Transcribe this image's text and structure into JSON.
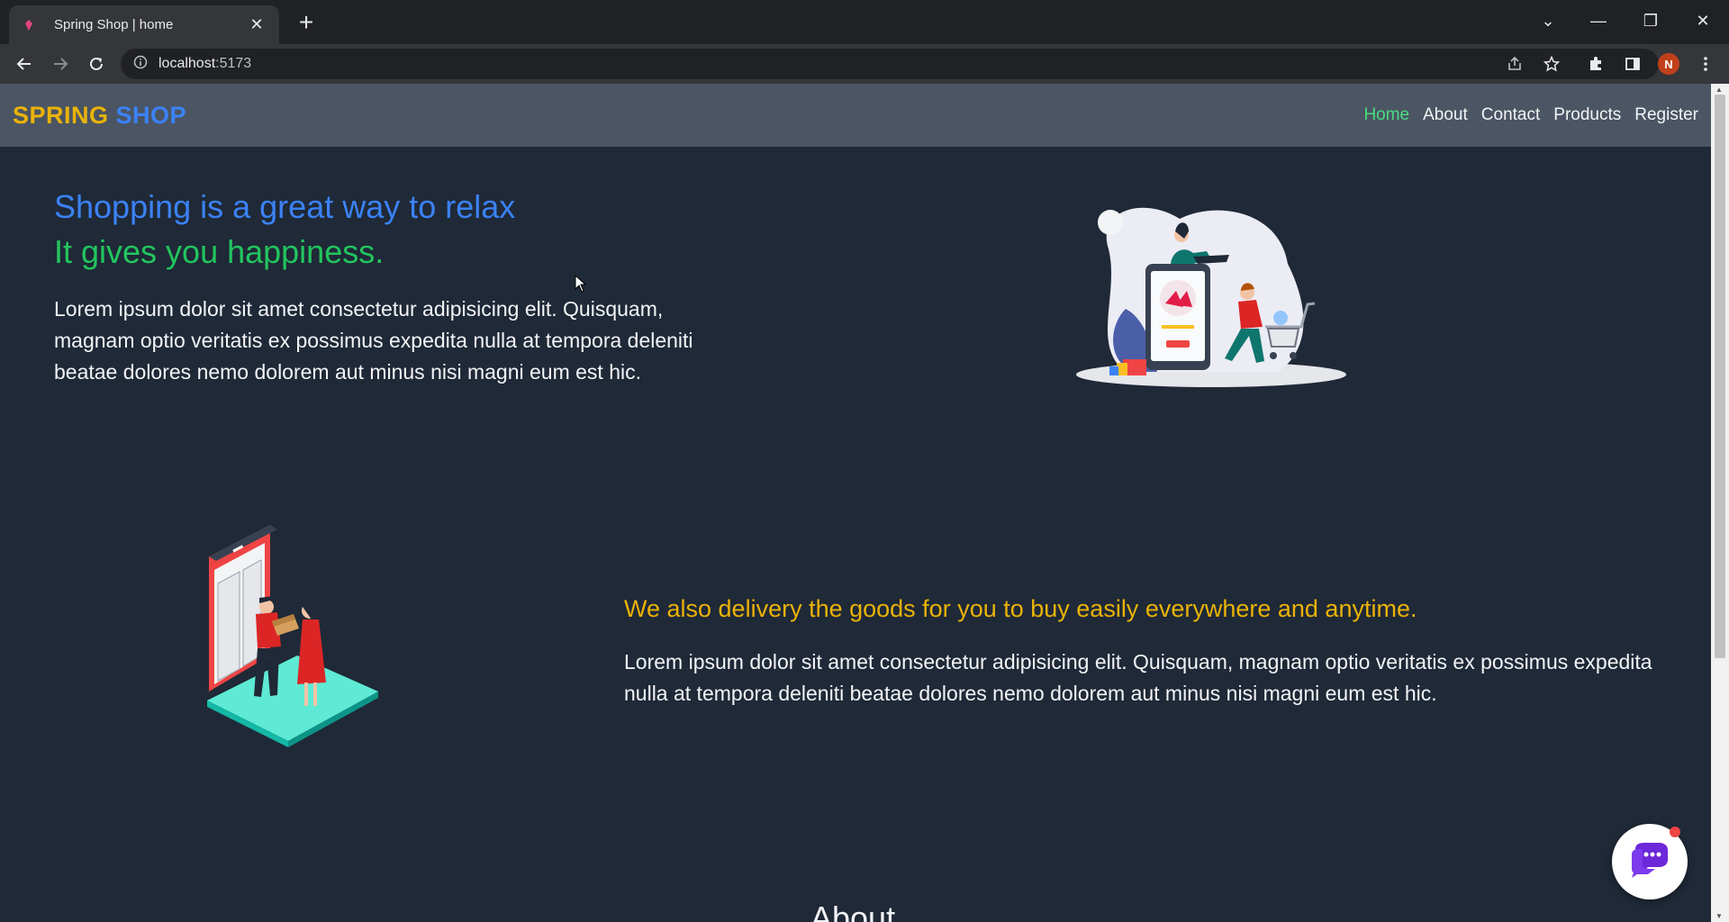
{
  "browser": {
    "tab_title": "Spring Shop | home",
    "url_host": "localhost",
    "url_port": ":5173",
    "profile_initial": "N",
    "icons": [
      "back-icon",
      "forward-icon",
      "reload-icon",
      "info-icon",
      "share-icon",
      "star-icon",
      "extensions-icon",
      "side-panel-icon",
      "menu-icon"
    ]
  },
  "navbar": {
    "brand_part1": "SPRING",
    "brand_part2": "SHOP",
    "links": [
      {
        "label": "Home",
        "active": true
      },
      {
        "label": "About",
        "active": false
      },
      {
        "label": "Contact",
        "active": false
      },
      {
        "label": "Products",
        "active": false
      },
      {
        "label": "Register",
        "active": false
      }
    ]
  },
  "hero": {
    "title": "Shopping is a great way to relax",
    "subtitle": "It gives you happiness.",
    "text": "Lorem ipsum dolor sit amet consectetur adipisicing elit. Quisquam, magnam optio veritatis ex possimus expedita nulla at tempora deleniti beatae dolores nemo dolorem aut minus nisi magni eum est hic."
  },
  "delivery": {
    "title": "We also delivery the goods for you to buy easily everywhere and anytime.",
    "text": "Lorem ipsum dolor sit amet consectetur adipisicing elit. Quisquam, magnam optio veritatis ex possimus expedita nulla at tempora deleniti beatae dolores nemo dolorem aut minus nisi magni eum est hic."
  },
  "about": {
    "heading": "About"
  },
  "colors": {
    "page_bg": "#1f2937",
    "navbar_bg": "#4b5563",
    "brand_yellow": "#eab308",
    "brand_blue": "#3b82f6",
    "active_green": "#4ade80",
    "subtitle_green": "#22c55e"
  }
}
